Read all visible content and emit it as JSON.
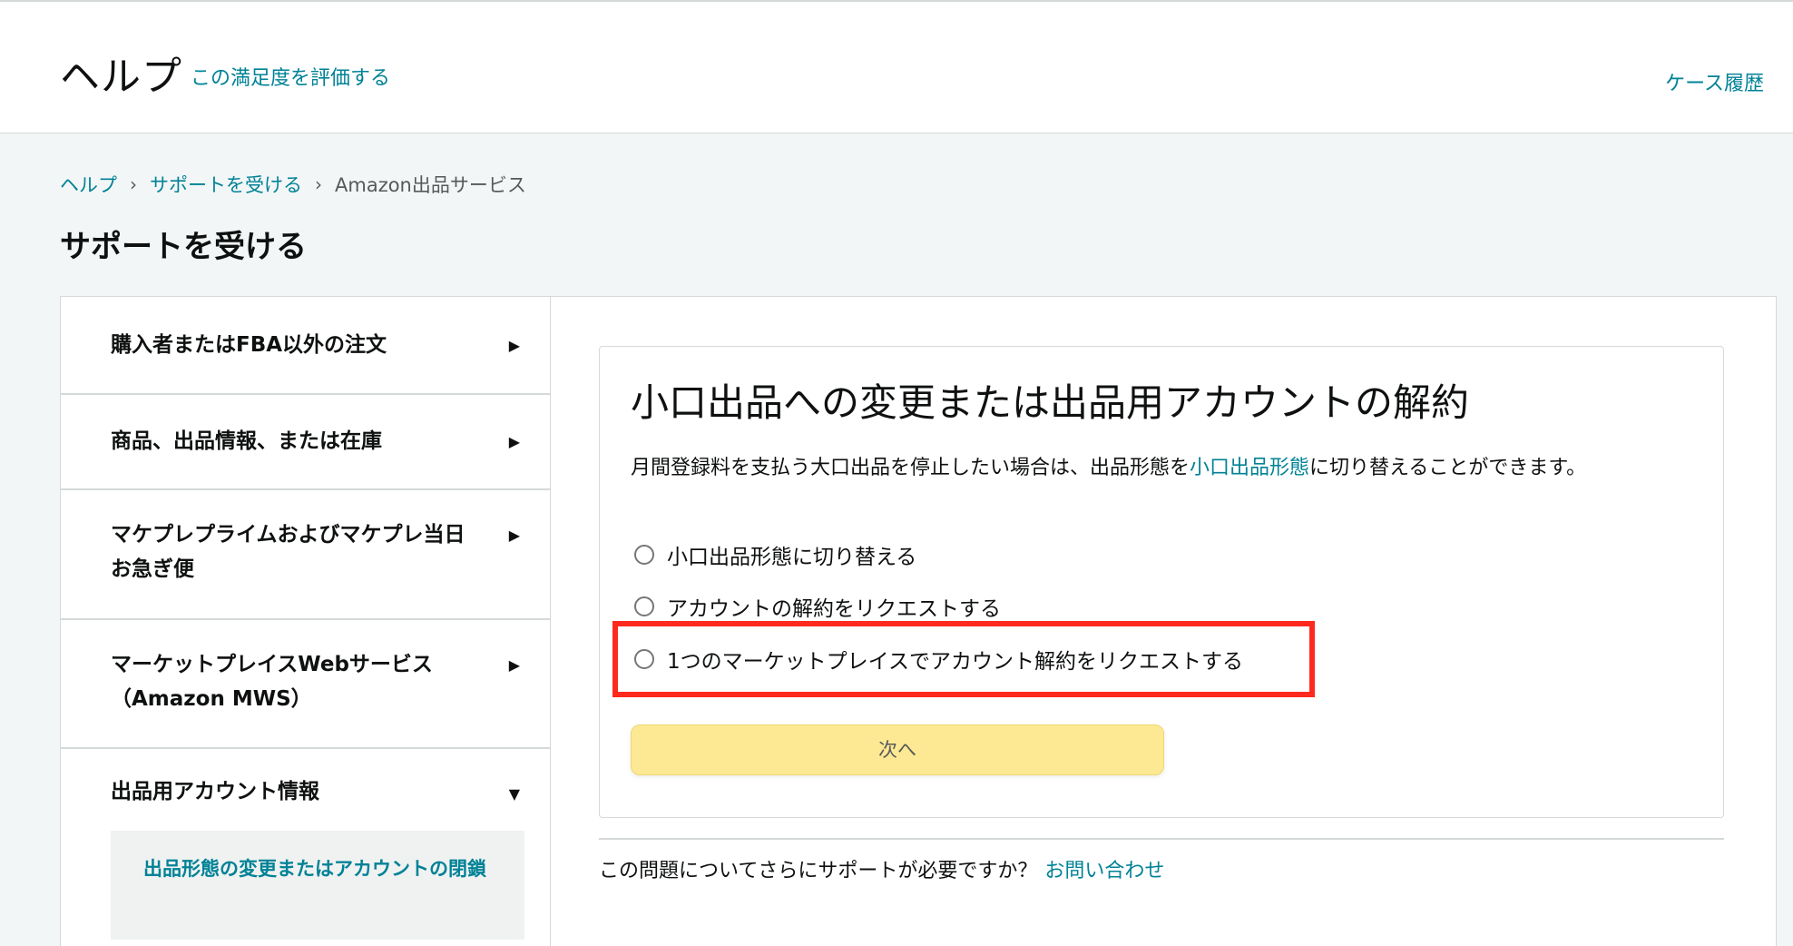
{
  "header": {
    "title": "ヘルプ",
    "rate_link": "この満足度を評価する",
    "case_history": "ケース履歴"
  },
  "breadcrumb": {
    "items": [
      "ヘルプ",
      "サポートを受ける"
    ],
    "current": "Amazon出品サービス",
    "separator": "›"
  },
  "page_title": "サポートを受ける",
  "sidebar": {
    "items": [
      {
        "label": "購入者またはFBA以外の注文",
        "arrow": "▶"
      },
      {
        "label": "商品、出品情報、または在庫",
        "arrow": "▶"
      },
      {
        "label": "マケプレプライムおよびマケプレ当日お急ぎ便",
        "arrow": "▶"
      },
      {
        "label": "マーケットプレイスWebサービス（Amazon MWS）",
        "arrow": "▶"
      },
      {
        "label": "出品用アカウント情報",
        "arrow": "▼"
      }
    ],
    "sub_item": "出品形態の変更またはアカウントの閉鎖"
  },
  "content": {
    "title": "小口出品への変更または出品用アカウントの解約",
    "desc_before": "月間登録料を支払う大口出品を停止したい場合は、出品形態を",
    "desc_link": "小口出品形態",
    "desc_after": "に切り替えることができます。",
    "options": [
      "小口出品形態に切り替える",
      "アカウントの解約をリクエストする",
      "1つのマーケットプレイスでアカウント解約をリクエストする"
    ],
    "next_button": "次へ"
  },
  "footer_help": {
    "text": "この問題についてさらにサポートが必要ですか？",
    "link": "お問い合わせ"
  },
  "colors": {
    "link": "#008296",
    "highlight": "#ff2a1f",
    "button": "#fde993"
  }
}
